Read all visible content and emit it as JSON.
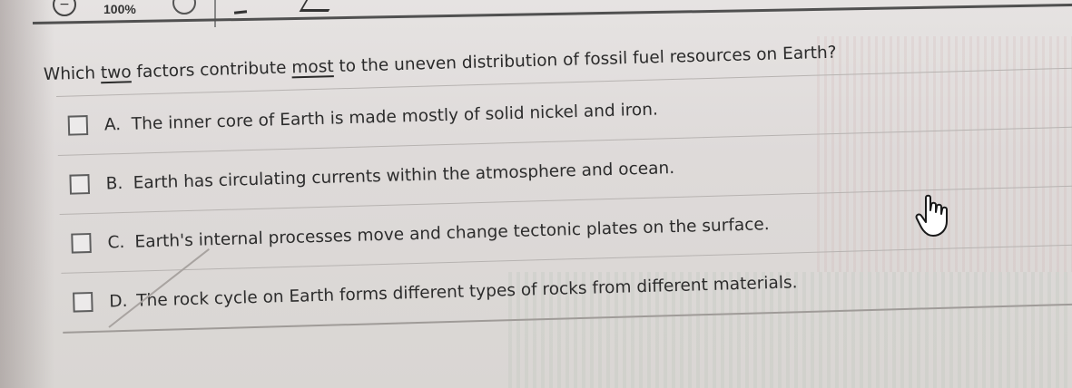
{
  "toolbar": {
    "zoom_level": "100%",
    "zoom_out_icon": "zoom-out-icon",
    "zoom_in_icon": "zoom-in-icon"
  },
  "question": {
    "prefix": "Which ",
    "emph1": "two",
    "middle": " factors contribute ",
    "emph2": "most",
    "suffix": " to the uneven distribution of fossil fuel resources on Earth?"
  },
  "options": [
    {
      "letter": "A.",
      "text": "The inner core of Earth is made mostly of solid nickel and iron.",
      "checked": false
    },
    {
      "letter": "B.",
      "text": "Earth has circulating currents within the atmosphere and ocean.",
      "checked": false
    },
    {
      "letter": "C.",
      "text": "Earth's internal processes move and change tectonic plates on the surface.",
      "checked": false
    },
    {
      "letter": "D.",
      "text": "The rock cycle on Earth forms different types of rocks from different materials.",
      "checked": false
    }
  ],
  "cursor": {
    "icon": "hand-pointer-icon"
  }
}
